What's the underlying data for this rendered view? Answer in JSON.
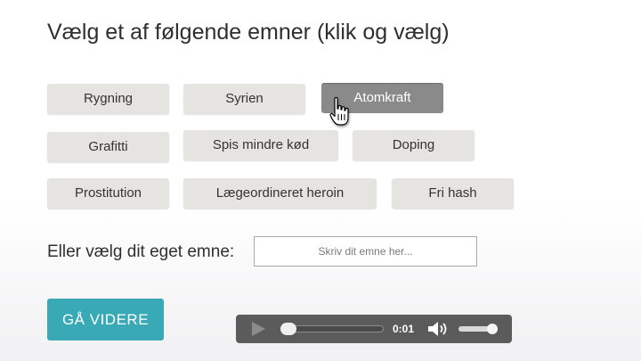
{
  "title": "Vælg et af følgende emner (klik og vælg)",
  "topics": [
    {
      "label": "Rygning"
    },
    {
      "label": "Syrien"
    },
    {
      "label": "Atomkraft",
      "selected": true
    },
    {
      "label": "Grafitti"
    },
    {
      "label": "Spis mindre kød"
    },
    {
      "label": "Doping"
    },
    {
      "label": "Prostitution"
    },
    {
      "label": "Lægeordineret heroin"
    },
    {
      "label": "Fri hash"
    }
  ],
  "own_topic": {
    "label": "Eller vælg dit eget emne:",
    "placeholder": "Skriv dit emne her...",
    "value": ""
  },
  "next_button": {
    "label": "GÅ VIDERE"
  },
  "audio_player": {
    "time": "0:01",
    "icons": [
      "play-icon",
      "volume-icon"
    ]
  },
  "colors": {
    "accent": "#3aa9b6",
    "selected_topic": "#8a8a8a",
    "topic_bg": "#e6e4e1",
    "player_bg": "#5b5b5b"
  }
}
